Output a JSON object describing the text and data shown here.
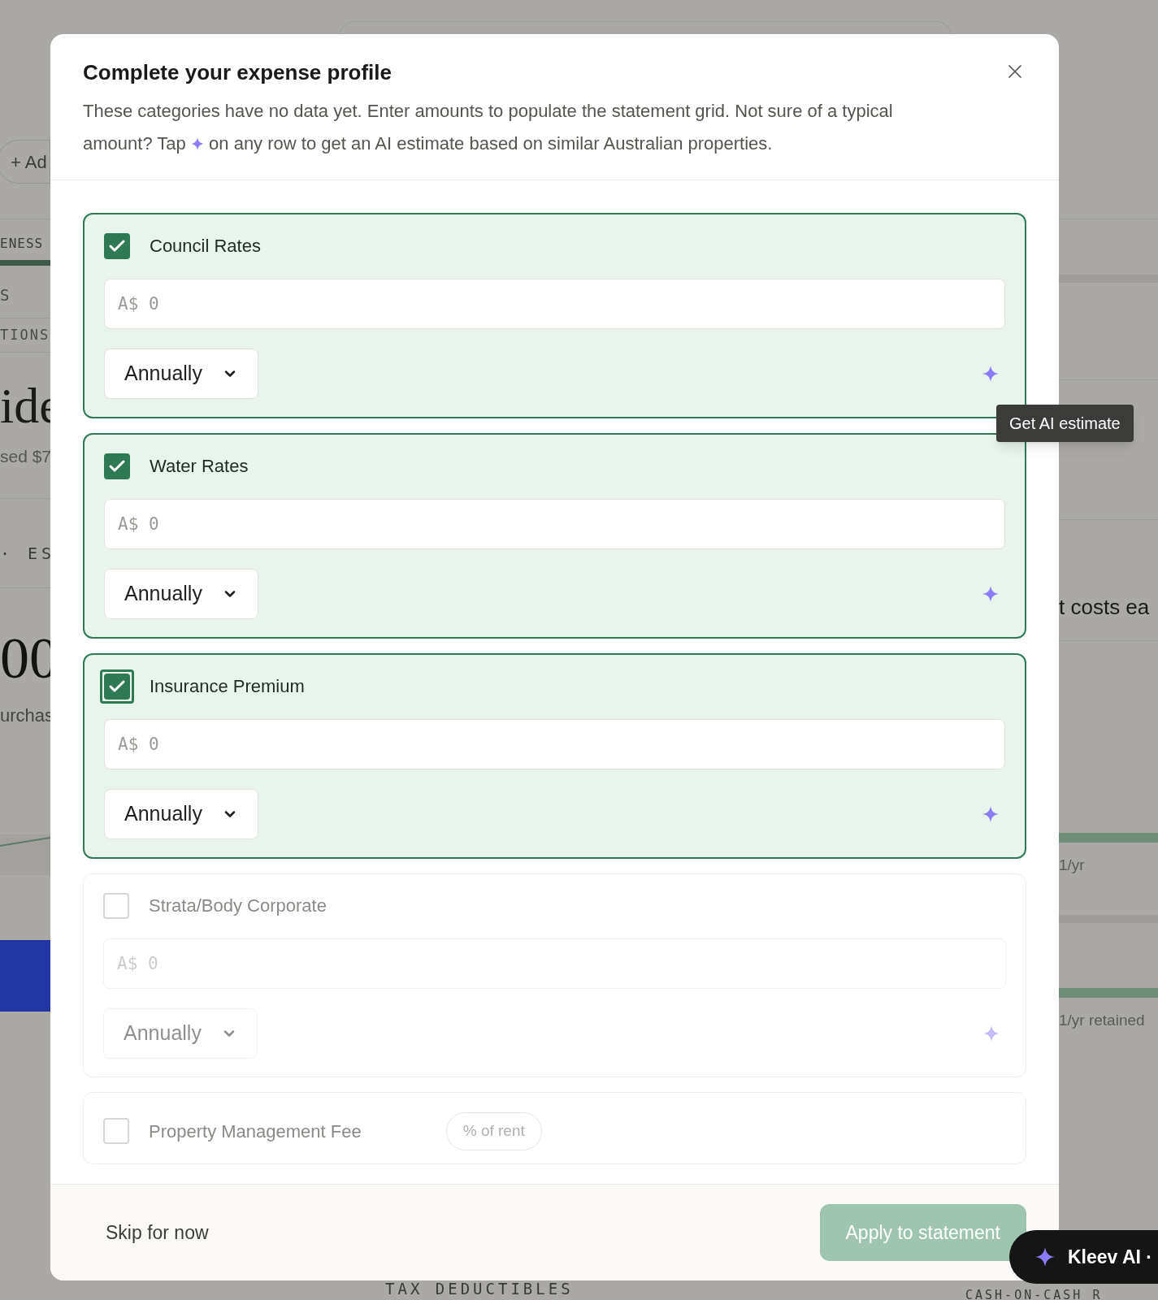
{
  "background": {
    "add_button": "+ Ad",
    "tab_label": "ENESS",
    "nav_items": [
      "S",
      "TIONS"
    ],
    "heading": "ide",
    "subheading": "sed $7",
    "section_label": "· ES",
    "big_value": "00",
    "caption": "urchas",
    "right_heading": "t costs ea",
    "right_captions": [
      "1/yr",
      "1/yr retained"
    ],
    "right_bars": [
      {
        "level": 1
      },
      {
        "level": 1
      }
    ],
    "bottom_labels": [
      "TAX DEDUCTIBLES",
      "CASH-ON-CASH R"
    ]
  },
  "modal": {
    "title": "Complete your expense profile",
    "description_before": "These categories have no data yet. Enter amounts to populate the statement grid. Not sure of a typical amount? Tap",
    "description_after": "on any row to get an AI estimate based on similar Australian properties.",
    "categories": [
      {
        "name": "Council Rates",
        "checked": true,
        "focused": false,
        "kind": "amount",
        "placeholder": "A$ 0",
        "frequency": "Annually"
      },
      {
        "name": "Water Rates",
        "checked": true,
        "focused": false,
        "kind": "amount",
        "placeholder": "A$ 0",
        "frequency": "Annually"
      },
      {
        "name": "Insurance Premium",
        "checked": true,
        "focused": true,
        "kind": "amount",
        "placeholder": "A$ 0",
        "frequency": "Annually"
      },
      {
        "name": "Strata/Body Corporate",
        "checked": false,
        "focused": false,
        "kind": "amount",
        "placeholder": "A$ 0",
        "frequency": "Annually"
      },
      {
        "name": "Property Management Fee",
        "checked": false,
        "focused": false,
        "kind": "percent",
        "unit": "% of rent"
      }
    ],
    "skip": "Skip for now",
    "apply": {
      "label": "Apply to statement",
      "disabled": true
    }
  },
  "tooltip": "Get AI estimate",
  "assistant": {
    "label": "Kleev AI ·"
  }
}
